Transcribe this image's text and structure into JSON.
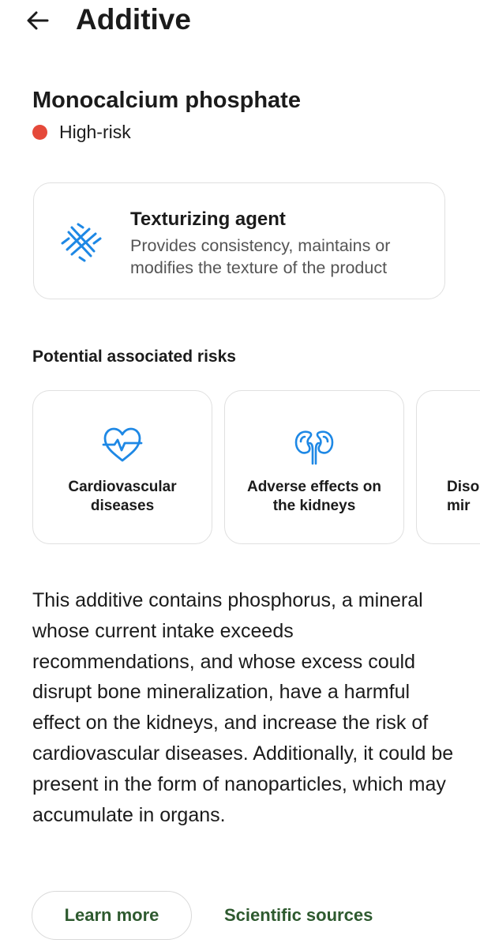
{
  "header": {
    "title": "Additive",
    "back_icon": "arrow-left-icon"
  },
  "additive": {
    "name": "Monocalcium phosphate",
    "risk_level": "High-risk",
    "risk_color": "#e5493a"
  },
  "function": {
    "icon": "texturizer-icon",
    "title": "Texturizing agent",
    "description": "Provides consistency, maintains or modifies the texture of the product",
    "accent_color": "#1e88e5"
  },
  "risks": {
    "heading": "Potential associated risks",
    "items": [
      {
        "label": "Cardiovascular diseases",
        "icon": "heart-pulse-icon"
      },
      {
        "label": "Adverse effects on the kidneys",
        "icon": "kidneys-icon"
      },
      {
        "label": "Diso\nmir",
        "icon": ""
      }
    ]
  },
  "description": "This additive contains phosphorus, a mineral whose current intake exceeds recommendations, and whose excess could disrupt bone mineralization, have a harmful effect on the kidneys, and increase the risk of cardiovascular diseases. Additionally, it could be present in the form of nanoparticles, which may accumulate in organs.",
  "actions": {
    "learn_more": "Learn more",
    "scientific_sources": "Scientific sources",
    "color": "#2e5a2f"
  }
}
